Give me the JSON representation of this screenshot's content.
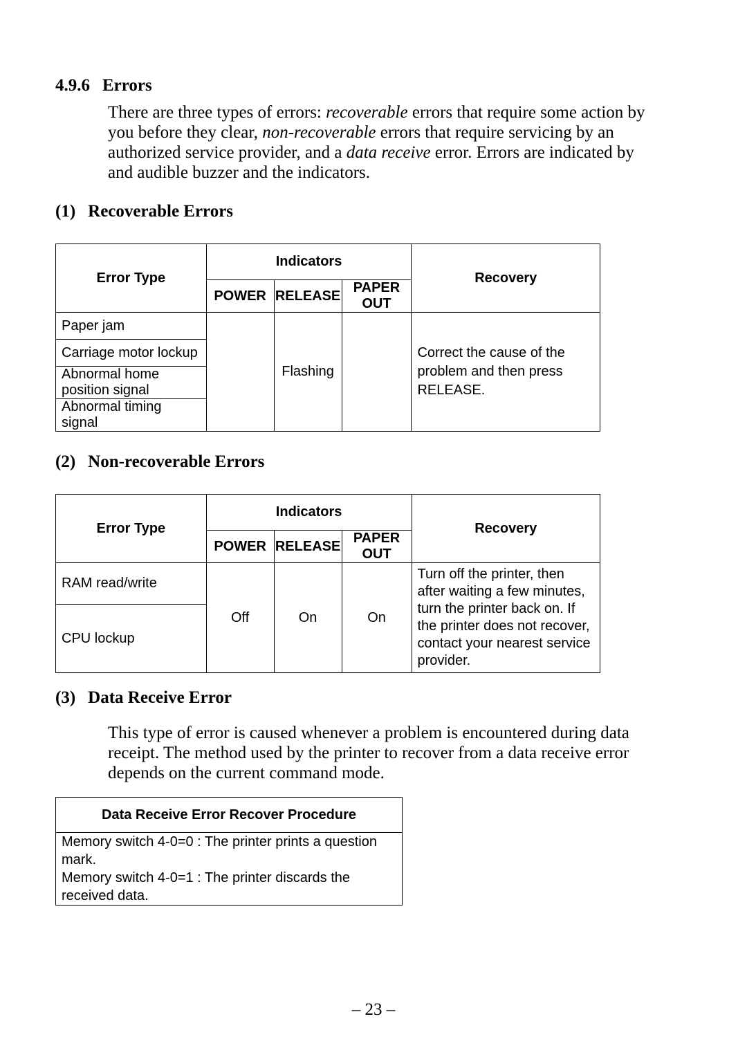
{
  "section": {
    "number": "4.9.6",
    "title": "Errors",
    "intro_parts": [
      "There are three types of errors: ",
      "recoverable",
      " errors that require some action by you before they clear, ",
      "non-recoverable",
      " errors that require servicing by an authorized service provider, and a ",
      "data receive",
      " error. Errors are indicated by and audible buzzer and the indicators."
    ]
  },
  "tables_common": {
    "hdr_error_type": "Error Type",
    "hdr_indicators": "Indicators",
    "hdr_power": "POWER",
    "hdr_release": "RELEASE",
    "hdr_paper_out": "PAPER OUT",
    "hdr_recovery": "Recovery"
  },
  "sub1": {
    "num": "(1)",
    "title": "Recoverable Errors",
    "rows": {
      "r1": "Paper jam",
      "r2": "Carriage motor lockup",
      "r3": "Abnormal home position signal",
      "r4": "Abnormal timing signal"
    },
    "power": "",
    "release": "Flashing",
    "paper_out": "",
    "recovery": "Correct the cause of the problem and then press RELEASE."
  },
  "sub2": {
    "num": "(2)",
    "title": "Non-recoverable Errors",
    "rows": {
      "r1": "RAM read/write",
      "r2": "CPU lockup"
    },
    "power": "Off",
    "release": "On",
    "paper_out": "On",
    "recovery": "Turn off the printer, then after waiting a few minutes, turn the printer back on. If the printer does not recover, contact your nearest service provider."
  },
  "sub3": {
    "num": "(3)",
    "title": "Data Receive Error",
    "body": "This type of error is caused whenever a problem is encountered during data receipt. The method used by the printer to recover from a data receive error depends on the current command mode.",
    "table_header": "Data Receive Error Recover Procedure",
    "table_line1": "Memory switch 4-0=0 : The printer prints a question mark.",
    "table_line2": "Memory switch 4-0=1 : The printer discards the received data."
  },
  "page_number": "– 23 –"
}
